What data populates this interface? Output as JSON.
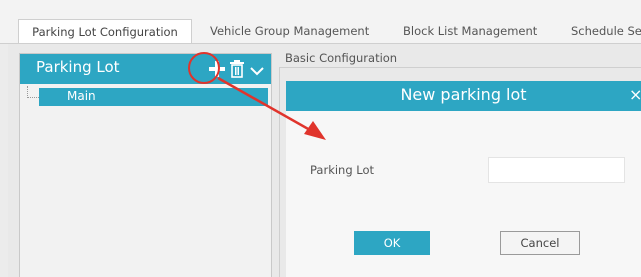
{
  "tabs": [
    {
      "label": "Parking Lot Configuration",
      "active": true
    },
    {
      "label": "Vehicle Group Management",
      "active": false
    },
    {
      "label": "Block List Management",
      "active": false
    },
    {
      "label": "Schedule Se",
      "active": false
    }
  ],
  "left_panel": {
    "title": "Parking Lot",
    "icons": [
      "plus-icon",
      "trash-icon",
      "chevron-down-icon"
    ],
    "tree": [
      {
        "label": "Main",
        "selected": true
      }
    ]
  },
  "basic_config": {
    "label": "Basic Configuration"
  },
  "dialog": {
    "title": "New parking lot",
    "close": "×",
    "field_label": "Parking Lot",
    "field_value": "",
    "ok_label": "OK",
    "cancel_label": "Cancel"
  },
  "colors": {
    "accent": "#2da6c3",
    "highlight_red": "#e0342c"
  }
}
